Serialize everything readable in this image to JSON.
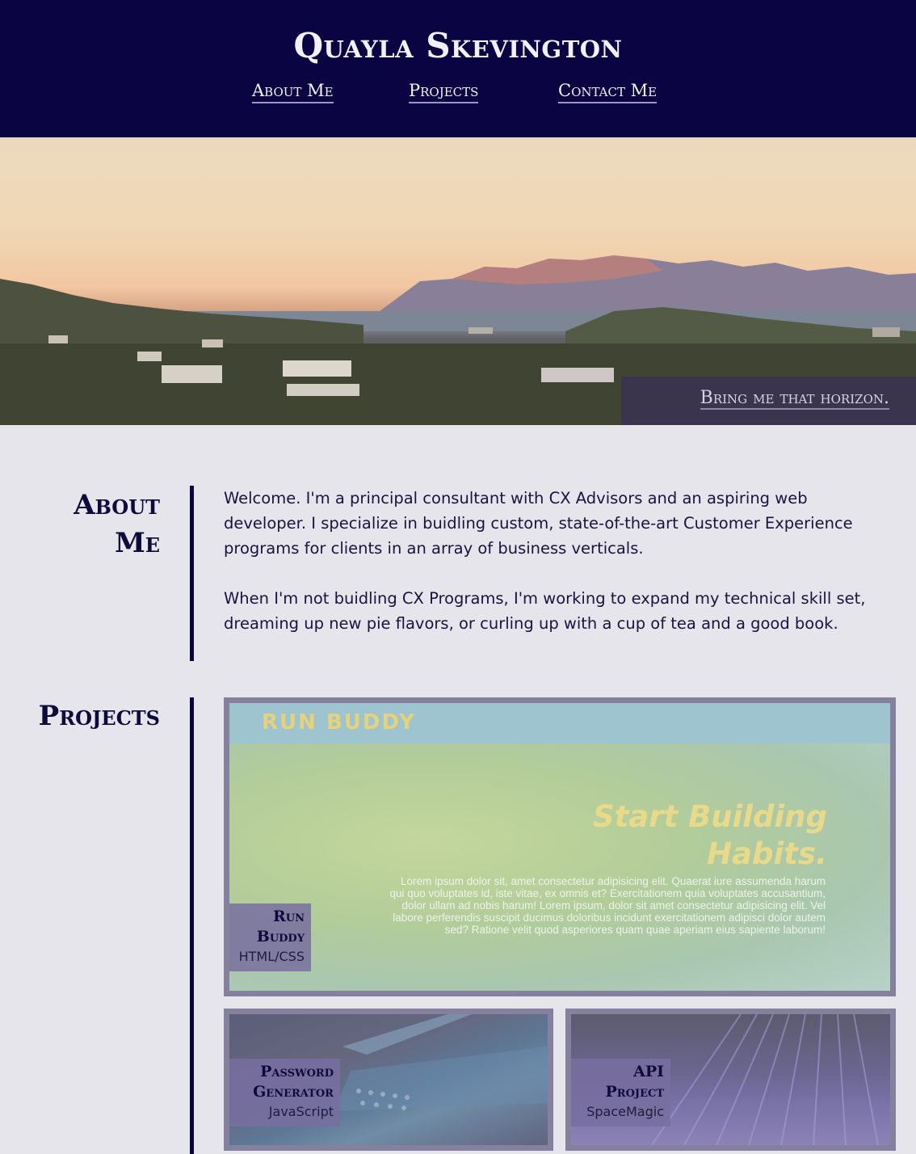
{
  "header": {
    "title": "Quayla Skevington",
    "nav": [
      "About Me",
      "Projects",
      "Contact Me"
    ]
  },
  "hero": {
    "tagline": "Bring me that horizon."
  },
  "about": {
    "heading": "About Me",
    "paragraphs": [
      "Welcome. I'm a principal consultant with CX Advisors and an aspiring web developer. I specialize in buidling custom, state-of-the-art Customer Experience programs for clients in an array of business verticals.",
      "When I'm not buidling CX Programs, I'm working to expand my technical skill set, dreaming up new pie flavors, or curling up with a cup of tea and a good book."
    ]
  },
  "projects": {
    "heading": "Projects",
    "items": [
      {
        "name": "Run Buddy",
        "tech": "HTML/CSS",
        "preview": {
          "brand": "RUN BUDDY",
          "headline_1": "Start Building",
          "headline_2": "Habits.",
          "body": "Lorem ipsum dolor sit, amet consectetur adipisicing elit. Quaerat iure assumenda harum qui quo voluptates id, iste vitae, ex omnis et? Exercitationem quia voluptates accusantium, dolor ullam ad nobis harum! Lorem ipsum, dolor sit amet consectetur adipisicing elit. Vel labore perferendis suscipit ducimus doloribus incidunt exercitationem adipisci dolor autem sed? Ratione velit quod asperiores quam quae aperiam eius sapiente laborum!"
        }
      },
      {
        "name": "Password Generator",
        "tech": "JavaScript"
      },
      {
        "name": "API Project",
        "tech": "SpaceMagic"
      }
    ]
  },
  "colors": {
    "header_bg": "#0a0542",
    "page_bg": "#e6e5ec",
    "accent": "#0e0a3c",
    "card_frame": "#86809f"
  }
}
